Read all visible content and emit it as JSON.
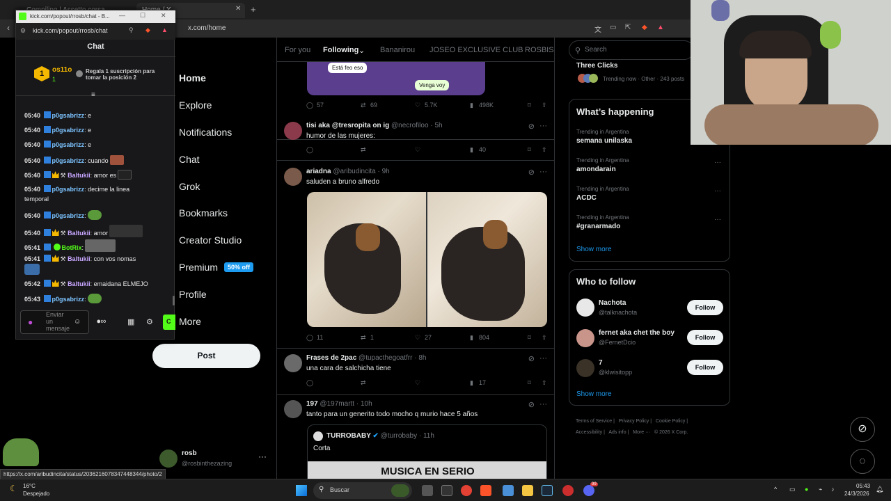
{
  "browser": {
    "tabs": [
      {
        "title": "Compiling | Assetto corsa"
      },
      {
        "title": "Home / X"
      }
    ],
    "url": "x.com/home",
    "status_url": "https://x.com/aribudincita/status/2036216078347448344/photo/2"
  },
  "kick": {
    "url": "kick.com/popout/rrosb/chat",
    "window_title": "kick.com/popout/rrosb/chat - B...",
    "header": "Chat",
    "top_user": "os11o",
    "top_rank": "1",
    "top_amount": "1",
    "promo": "Regala 1 suscripción para tomar la posición 2",
    "messages": [
      {
        "time": "05:40",
        "user": "p0gsabrizz",
        "text": ": e"
      },
      {
        "time": "05:40",
        "user": "p0gsabrizz",
        "text": ": e"
      },
      {
        "time": "05:40",
        "user": "p0gsabrizz",
        "text": ": e"
      },
      {
        "time": "05:40",
        "user": "p0gsabrizz",
        "text": ": cuando"
      },
      {
        "time": "05:40",
        "user": "Baltukii",
        "text": ": amor es"
      },
      {
        "time": "05:40",
        "user": "p0gsabrizz",
        "text": ": decime la linea"
      },
      {
        "time": "",
        "user": "",
        "text": "temporal"
      },
      {
        "time": "05:40",
        "user": "p0gsabrizz",
        "text": ":"
      },
      {
        "time": "05:40",
        "user": "Baltukii",
        "text": ": amor"
      },
      {
        "time": "05:41",
        "user": "BotRix",
        "text": ":"
      },
      {
        "time": "05:41",
        "user": "Baltukii",
        "text": ": con vos nomas"
      },
      {
        "time": "05:42",
        "user": "Baltukii",
        "text": ": emaidana ELMEJO"
      },
      {
        "time": "05:43",
        "user": "p0gsabrizz",
        "text": ":"
      }
    ],
    "input_placeholder": "Enviar un mensaje"
  },
  "nav": {
    "items": [
      "Home",
      "Explore",
      "Notifications",
      "Chat",
      "Grok",
      "Bookmarks",
      "Creator Studio",
      "Premium",
      "Profile",
      "More"
    ],
    "premium_badge": "50% off",
    "post": "Post",
    "me_name": "rosb",
    "me_handle": "@rosbinthezazing"
  },
  "timeline": {
    "tabs": [
      "For you",
      "Following",
      "Bananirou",
      "JOSEO EXCLUSIVE CLUB",
      "ROSBISI"
    ],
    "top_bubbles": [
      "Está feo eso",
      "Venga voy"
    ],
    "top_actions": [
      "57",
      "69",
      "5.7K",
      "498K"
    ],
    "tweets": [
      {
        "name": "tisi aka @tresropita on ig",
        "handle": "@necrofiloo",
        "time": "5h",
        "text": "humor de las mujeres:",
        "replies": "",
        "reposts": "",
        "likes": "",
        "views": "40"
      },
      {
        "name": "ariadna",
        "handle": "@aribudincita",
        "time": "9h",
        "text": "saluden a bruno alfredo",
        "replies": "11",
        "reposts": "1",
        "likes": "27",
        "views": "804"
      },
      {
        "name": "Frases de 2pac",
        "handle": "@tupacthegoatfrr",
        "time": "8h",
        "text": "una cara de salchicha tiene",
        "replies": "",
        "reposts": "",
        "likes": "",
        "views": "17"
      },
      {
        "name": "197",
        "handle": "@197martt",
        "time": "10h",
        "text": "tanto para un generito todo mocho q murio hace 5 años",
        "replies": "",
        "reposts": "",
        "likes": "",
        "views": ""
      }
    ],
    "quote": {
      "name": "TURROBABY",
      "handle": "@turrobaby",
      "time": "11h",
      "text": "Corta",
      "banner": "MUSICA EN SERIO"
    }
  },
  "right": {
    "search_placeholder": "Search",
    "top_trend_name": "Three Clicks",
    "top_trend_meta": "Trending now · Other · 243 posts",
    "happening_title": "What’s happening",
    "trends": [
      {
        "meta": "Trending in Argentina",
        "name": "semana unilaska"
      },
      {
        "meta": "Trending in Argentina",
        "name": "amondarain"
      },
      {
        "meta": "Trending in Argentina",
        "name": "ACDC"
      },
      {
        "meta": "Trending in Argentina",
        "name": "#granarmado"
      }
    ],
    "show_more": "Show more",
    "who_title": "Who to follow",
    "follow": [
      {
        "name": "Nachota",
        "handle": "@talknachota"
      },
      {
        "name": "fernet aka chet the boy",
        "handle": "@FernetDcio"
      },
      {
        "name": "7",
        "handle": "@klwisitopp"
      }
    ],
    "follow_label": "Follow",
    "footer": [
      "Terms of Service",
      "Privacy Policy",
      "Cookie Policy",
      "Accessibility",
      "Ads info",
      "More ···",
      "© 2026 X Corp."
    ]
  },
  "taskbar": {
    "weather_temp": "16°C",
    "weather_text": "Despejado",
    "search": "Buscar",
    "time": "05:43",
    "date": "24/3/2026",
    "notif_badge": "99"
  }
}
